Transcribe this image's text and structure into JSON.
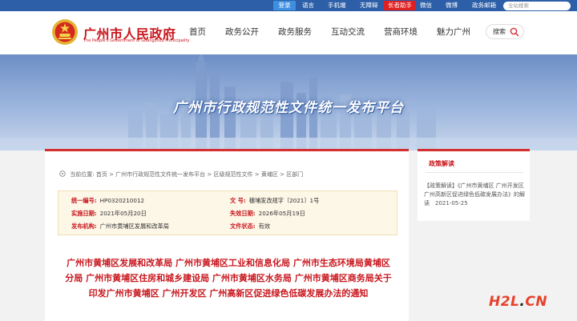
{
  "topbar": {
    "login": "登录",
    "language": "语言",
    "mobile": "手机端",
    "accessible": "无障碍",
    "elder_mode": "长者助手",
    "wechat": "微信",
    "weibo": "微博",
    "gov_service": "政务邮箱",
    "search_placeholder": "全站搜索"
  },
  "header": {
    "title": "广州市人民政府",
    "subtitle_en": "The People's Government of Guangzhou Municipality",
    "nav": [
      "首页",
      "政务公开",
      "政务服务",
      "互动交流",
      "营商环境",
      "魅力广州"
    ],
    "search_label": "搜索"
  },
  "banner": {
    "title": "广州市行政规范性文件统一发布平台"
  },
  "breadcrumb": {
    "label": "当前位置:",
    "items": [
      "首页",
      "广州市行政规范性文件统一发布平台",
      "区级规范性文件",
      "黄埔区",
      "区部门"
    ],
    "sep": ">"
  },
  "info": {
    "serial_label": "统一编号:",
    "serial": "HP0320210012",
    "docno_label": "文 号:",
    "docno": "穗埔发改规字〔2021〕1号",
    "date_label": "实施日期:",
    "date": "2021年05月20日",
    "expiry_label": "失效日期:",
    "expiry": "2026年05月19日",
    "org_label": "发布机构:",
    "org": "广州市黄埔区发展和改革局",
    "status_label": "文件状态:",
    "status": "有效"
  },
  "document": {
    "title": "广州市黄埔区发展和改革局 广州市黄埔区工业和信息化局 广州市生态环境局黄埔区分局 广州市黄埔区住房和城乡建设局 广州市黄埔区水务局 广州市黄埔区商务局关于印发广州市黄埔区 广州开发区 广州高新区促进绿色低碳发展办法的通知"
  },
  "side": {
    "heading": "政策解读",
    "text": "【政策解读】《广州市黄埔区 广州开发区 广州高新区促进绿色低碳发展办法》的解读　2021-05-25"
  },
  "watermark": {
    "left": "H2L",
    "dot": ".",
    "right": "CN"
  },
  "colors": {
    "primary_red": "#c8161d",
    "topbar_blue": "#2c5fa8",
    "info_bg": "#fdf7e8"
  }
}
